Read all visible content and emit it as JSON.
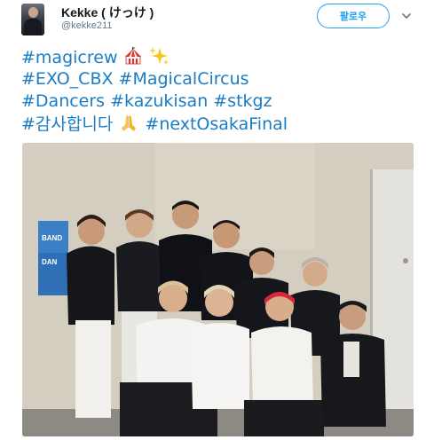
{
  "user": {
    "display_name": "Kekke ( けっけ )",
    "handle": "@kekke211"
  },
  "actions": {
    "follow_label": "팔로우"
  },
  "tweet": {
    "lines": [
      "#magicrew",
      "#EXO_CBX #MagicalCircus",
      "#Dancers #kazukisan #stkgz",
      "#감사합니다",
      "#nextOsakaFinal"
    ]
  },
  "photo": {
    "poster_text": [
      "BAND",
      "DAN"
    ]
  },
  "colors": {
    "link": "#1b7cc4",
    "follow": "#1da1f2",
    "muted": "#657786"
  },
  "icons": [
    "circus-tent-icon",
    "sparkles-icon",
    "folded-hands-icon",
    "chevron-down-icon"
  ]
}
